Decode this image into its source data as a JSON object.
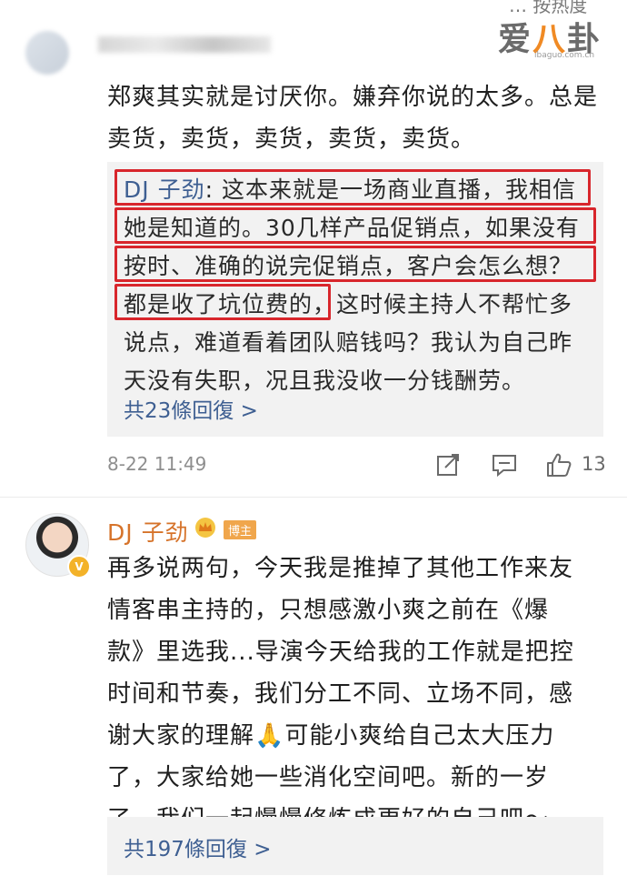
{
  "watermark": {
    "brand_left": "爱",
    "brand_mid": "八",
    "brand_right": "卦",
    "domain": "ibaguo.com.cn"
  },
  "sort_hint": "… 按热度",
  "comment1": {
    "text": "郑爽其实就是讨厌你。嫌弃你说的太多。总是卖货，卖货，卖货，卖货，卖货。",
    "reply": {
      "author": "DJ 子劲",
      "line1": ": 这本来就是一场商业直播，我相信",
      "line2": "她是知道的。30几样产品促销点，如果没有",
      "line3": "按时、准确的说完促销点，客户会怎么想？",
      "line4a": "都是收了坑位费的，",
      "line4b": "这时候主持人不帮忙多",
      "line5": "说点，难道看着团队赔钱吗？我认为自己昨",
      "line6": "天没有失职，况且我没收一分钱酬劳。"
    },
    "reply_count": "共23條回復 >",
    "timestamp": "8-22 11:49",
    "like_count": "13"
  },
  "comment2": {
    "author": "DJ 子劲",
    "owner_tag": "博主",
    "lines": [
      "再多说两句，今天我是推掉了其他工作来友",
      "情客串主持的，只想感激小爽之前在《爆",
      "款》里选我...导演今天给我的工作就是把控",
      "时间和节奏，我们分工不同、立场不同，感",
      "谢大家的理解🙏可能小爽给自己太大压力",
      "了，大家给她一些消化空间吧。新的一岁",
      "了，我们一起慢慢修炼成更好的自己吧～"
    ],
    "reply_count": "共197條回復 >"
  },
  "colors": {
    "link_blue": "#3e5f92",
    "highlight_red": "#d8262c",
    "owner_orange": "#d6732a"
  }
}
